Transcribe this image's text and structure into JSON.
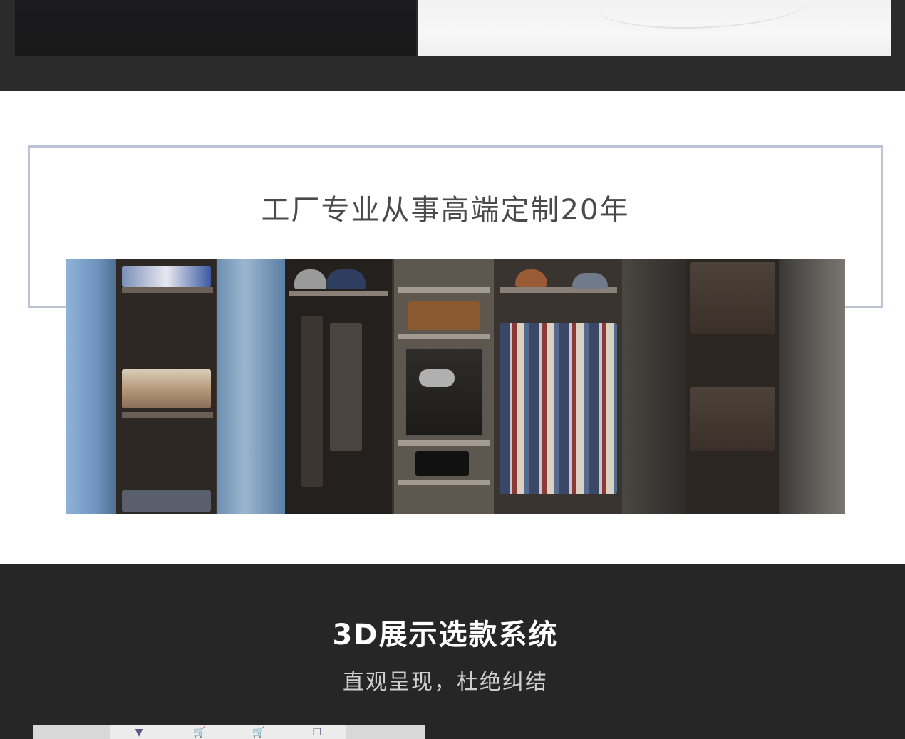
{
  "factory_section": {
    "title": "工厂专业从事高端定制20年"
  },
  "system_section": {
    "title": "3D展示选款系统",
    "subtitle": "直观呈现，杜绝纠结"
  },
  "toolbar": {
    "icons": [
      "suit-icon",
      "cart-icon",
      "cart-icon",
      "copy-icon"
    ]
  },
  "colors": {
    "dark_band": "#2b2b2b",
    "frame_border": "#bcc3d4",
    "title_text": "#4a4a4a",
    "bottom_band": "#262626"
  }
}
